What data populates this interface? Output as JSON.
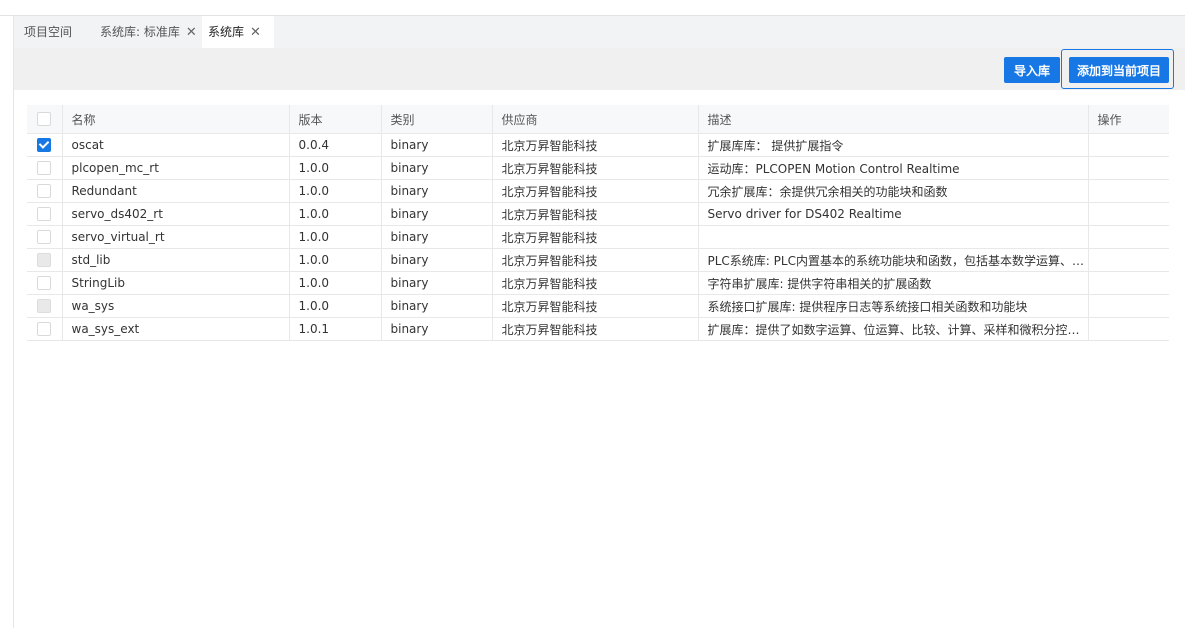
{
  "tabs": [
    {
      "label": "项目空间",
      "closable": false,
      "active": false
    },
    {
      "label": "系统库: 标准库",
      "closable": true,
      "active": false
    },
    {
      "label": "系统库",
      "closable": true,
      "active": true
    }
  ],
  "toolbar": {
    "import_label": "导入库",
    "add_label": "添加到当前项目"
  },
  "table": {
    "columns": [
      "名称",
      "版本",
      "类别",
      "供应商",
      "描述",
      "操作"
    ],
    "rows": [
      {
        "name": "oscat",
        "version": "0.0.4",
        "category": "binary",
        "vendor": "北京万昇智能科技",
        "description": "扩展库库： 提供扩展指令",
        "action": "",
        "checkbox": "checked"
      },
      {
        "name": "plcopen_mc_rt",
        "version": "1.0.0",
        "category": "binary",
        "vendor": "北京万昇智能科技",
        "description": "运动库：PLCOPEN Motion Control Realtime",
        "action": "",
        "checkbox": "unchecked"
      },
      {
        "name": "Redundant",
        "version": "1.0.0",
        "category": "binary",
        "vendor": "北京万昇智能科技",
        "description": "冗余扩展库：余提供冗余相关的功能块和函数",
        "action": "",
        "checkbox": "unchecked"
      },
      {
        "name": "servo_ds402_rt",
        "version": "1.0.0",
        "category": "binary",
        "vendor": "北京万昇智能科技",
        "description": "Servo driver for DS402 Realtime",
        "action": "",
        "checkbox": "unchecked"
      },
      {
        "name": "servo_virtual_rt",
        "version": "1.0.0",
        "category": "binary",
        "vendor": "北京万昇智能科技",
        "description": "",
        "action": "",
        "checkbox": "unchecked"
      },
      {
        "name": "std_lib",
        "version": "1.0.0",
        "category": "binary",
        "vendor": "北京万昇智能科技",
        "description": "PLC系统库: PLC内置基本的系统功能块和函数，包括基本数学运算、逻...",
        "action": "",
        "checkbox": "disabled"
      },
      {
        "name": "StringLib",
        "version": "1.0.0",
        "category": "binary",
        "vendor": "北京万昇智能科技",
        "description": "字符串扩展库: 提供字符串相关的扩展函数",
        "action": "",
        "checkbox": "unchecked"
      },
      {
        "name": "wa_sys",
        "version": "1.0.0",
        "category": "binary",
        "vendor": "北京万昇智能科技",
        "description": "系统接口扩展库: 提供程序日志等系统接口相关函数和功能块",
        "action": "",
        "checkbox": "disabled"
      },
      {
        "name": "wa_sys_ext",
        "version": "1.0.1",
        "category": "binary",
        "vendor": "北京万昇智能科技",
        "description": "扩展库：提供了如数字运算、位运算、比较、计算、采样和微积分控制...",
        "action": "",
        "checkbox": "unchecked"
      }
    ]
  },
  "colors": {
    "accent": "#1677e5",
    "tabbar_bg": "#f2f3f5",
    "toolbar_bg": "#f0f0f0"
  }
}
